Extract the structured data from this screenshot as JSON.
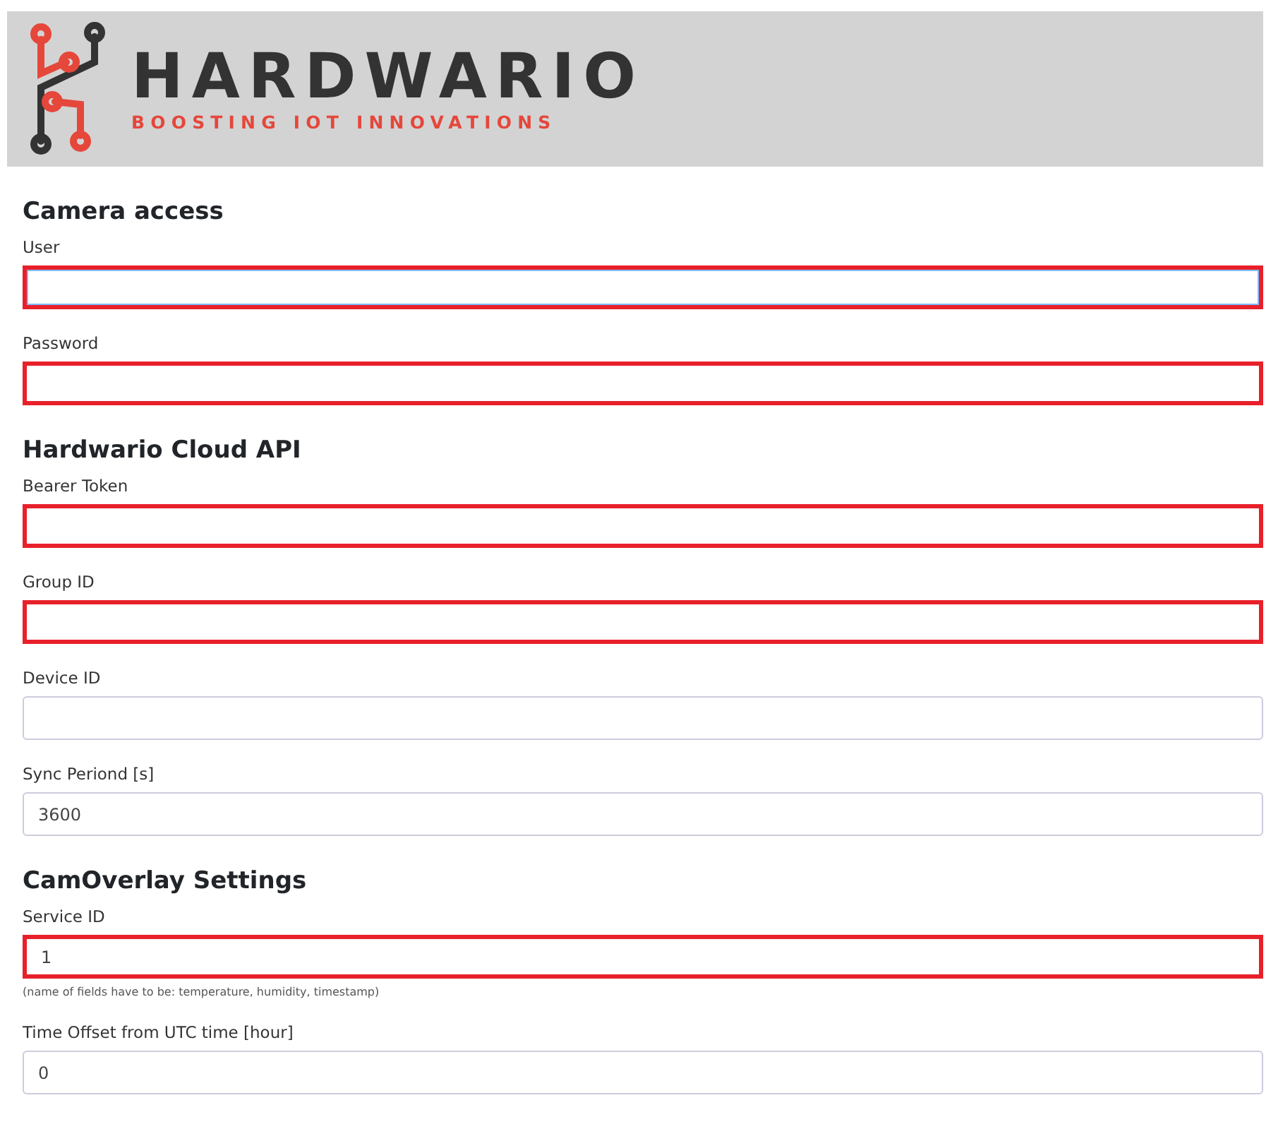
{
  "banner": {
    "brand": "HARDWARIO",
    "tagline": "BOOSTING IOT INNOVATIONS"
  },
  "sections": [
    {
      "title": "Camera access",
      "fields": [
        {
          "label": "User",
          "focused": true,
          "highlighted": true
        },
        {
          "label": "Password",
          "focused": false,
          "highlighted": true
        }
      ]
    },
    {
      "title": "Hardwario Cloud API",
      "fields": [
        {
          "label": "Bearer Token",
          "focused": false,
          "highlighted": true
        },
        {
          "label": "Group ID",
          "focused": false,
          "highlighted": true
        },
        {
          "label": "Device ID",
          "focused": false,
          "highlighted": false
        },
        {
          "label": "Sync Periond [s]",
          "value": "3600",
          "focused": false,
          "highlighted": false
        }
      ]
    },
    {
      "title": "CamOverlay Settings",
      "fields": [
        {
          "label": "Service ID",
          "value": "1",
          "focused": false,
          "highlighted": true,
          "hint": "(name of fields have to be: temperature, humidity, timestamp)"
        },
        {
          "label": "Time Offset from UTC time [hour]",
          "value": "0",
          "focused": false,
          "highlighted": false
        }
      ]
    }
  ]
}
